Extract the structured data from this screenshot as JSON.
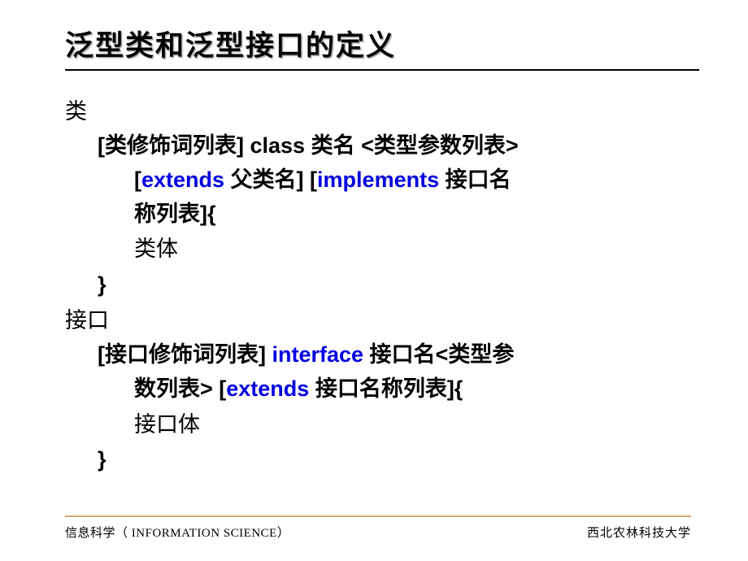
{
  "title": "泛型类和泛型接口的定义",
  "sections": {
    "class": {
      "label": "类",
      "line1_a": "[类修饰词列表] ",
      "line1_class": "class",
      "line1_b": " 类名 <类型参数列表>",
      "line2_a": "[",
      "line2_ext": "extends",
      "line2_b": " 父类名] [",
      "line2_impl": "implements",
      "line2_c": " 接口名",
      "line3": "称列表]{",
      "body": "类体",
      "close": "}"
    },
    "interface": {
      "label": "接口",
      "line1_a": "[接口修饰词列表] ",
      "line1_iface": "interface",
      "line1_b": " 接口名<类型参",
      "line2_a": "数列表> [",
      "line2_ext": "extends",
      "line2_b": " 接口名称列表]{",
      "body": " 接口体",
      "close": "}"
    }
  },
  "footer": {
    "left": "信息科学（ INFORMATION SCIENCE）",
    "right": "西北农林科技大学"
  }
}
